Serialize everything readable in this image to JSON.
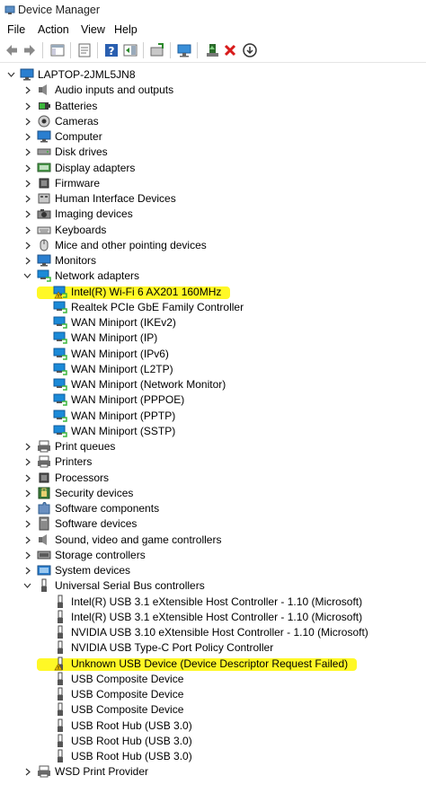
{
  "window": {
    "title": "Device Manager"
  },
  "menu": [
    "File",
    "Action",
    "View",
    "Help"
  ],
  "toolbar": {
    "buttons": [
      "back-icon",
      "forward-icon",
      "show-hide-console-tree-icon",
      "properties-icon",
      "help-icon",
      "action-pane-icon",
      "update-driver-icon",
      "scan-hardware-icon",
      "enable-device-icon",
      "uninstall-device-icon",
      "disable-device-icon"
    ]
  },
  "tree": {
    "root": "LAPTOP-2JML5JN8",
    "nodes": [
      {
        "label": "Audio inputs and outputs",
        "icon": "speaker",
        "expanded": false
      },
      {
        "label": "Batteries",
        "icon": "battery",
        "expanded": false
      },
      {
        "label": "Cameras",
        "icon": "camera",
        "expanded": false
      },
      {
        "label": "Computer",
        "icon": "monitor",
        "expanded": false
      },
      {
        "label": "Disk drives",
        "icon": "disk",
        "expanded": false
      },
      {
        "label": "Display adapters",
        "icon": "display",
        "expanded": false
      },
      {
        "label": "Firmware",
        "icon": "chip",
        "expanded": false
      },
      {
        "label": "Human Interface Devices",
        "icon": "hid",
        "expanded": false
      },
      {
        "label": "Imaging devices",
        "icon": "imaging",
        "expanded": false
      },
      {
        "label": "Keyboards",
        "icon": "keyboard",
        "expanded": false
      },
      {
        "label": "Mice and other pointing devices",
        "icon": "mouse",
        "expanded": false
      },
      {
        "label": "Monitors",
        "icon": "monitor",
        "expanded": false
      },
      {
        "label": "Network adapters",
        "icon": "network",
        "expanded": true,
        "children": [
          {
            "label": "Intel(R) Wi-Fi 6 AX201 160MHz",
            "icon": "network",
            "warning": true
          },
          {
            "label": "Realtek PCIe GbE Family Controller",
            "icon": "network"
          },
          {
            "label": "WAN Miniport (IKEv2)",
            "icon": "network"
          },
          {
            "label": "WAN Miniport (IP)",
            "icon": "network"
          },
          {
            "label": "WAN Miniport (IPv6)",
            "icon": "network"
          },
          {
            "label": "WAN Miniport (L2TP)",
            "icon": "network"
          },
          {
            "label": "WAN Miniport (Network Monitor)",
            "icon": "network"
          },
          {
            "label": "WAN Miniport (PPPOE)",
            "icon": "network"
          },
          {
            "label": "WAN Miniport (PPTP)",
            "icon": "network"
          },
          {
            "label": "WAN Miniport (SSTP)",
            "icon": "network"
          }
        ]
      },
      {
        "label": "Print queues",
        "icon": "printer",
        "expanded": false
      },
      {
        "label": "Printers",
        "icon": "printer",
        "expanded": false
      },
      {
        "label": "Processors",
        "icon": "chip",
        "expanded": false
      },
      {
        "label": "Security devices",
        "icon": "security",
        "expanded": false
      },
      {
        "label": "Software components",
        "icon": "puzzle",
        "expanded": false
      },
      {
        "label": "Software devices",
        "icon": "software",
        "expanded": false
      },
      {
        "label": "Sound, video and game controllers",
        "icon": "speaker",
        "expanded": false
      },
      {
        "label": "Storage controllers",
        "icon": "storage",
        "expanded": false
      },
      {
        "label": "System devices",
        "icon": "system",
        "expanded": false
      },
      {
        "label": "Universal Serial Bus controllers",
        "icon": "usb",
        "expanded": true,
        "children": [
          {
            "label": "Intel(R) USB 3.1 eXtensible Host Controller - 1.10 (Microsoft)",
            "icon": "usb"
          },
          {
            "label": "Intel(R) USB 3.1 eXtensible Host Controller - 1.10 (Microsoft)",
            "icon": "usb"
          },
          {
            "label": "NVIDIA USB 3.10 eXtensible Host Controller - 1.10 (Microsoft)",
            "icon": "usb"
          },
          {
            "label": "NVIDIA USB Type-C Port Policy Controller",
            "icon": "usb"
          },
          {
            "label": "Unknown USB Device (Device Descriptor Request Failed)",
            "icon": "usb",
            "warning": true
          },
          {
            "label": "USB Composite Device",
            "icon": "usb"
          },
          {
            "label": "USB Composite Device",
            "icon": "usb"
          },
          {
            "label": "USB Composite Device",
            "icon": "usb"
          },
          {
            "label": "USB Root Hub (USB 3.0)",
            "icon": "usb"
          },
          {
            "label": "USB Root Hub (USB 3.0)",
            "icon": "usb"
          },
          {
            "label": "USB Root Hub (USB 3.0)",
            "icon": "usb"
          }
        ]
      },
      {
        "label": "WSD Print Provider",
        "icon": "printer",
        "expanded": false
      }
    ]
  },
  "colors": {
    "highlight": "#fff700",
    "network_icon": "#1b8ad8",
    "warning": "#f2c200"
  }
}
